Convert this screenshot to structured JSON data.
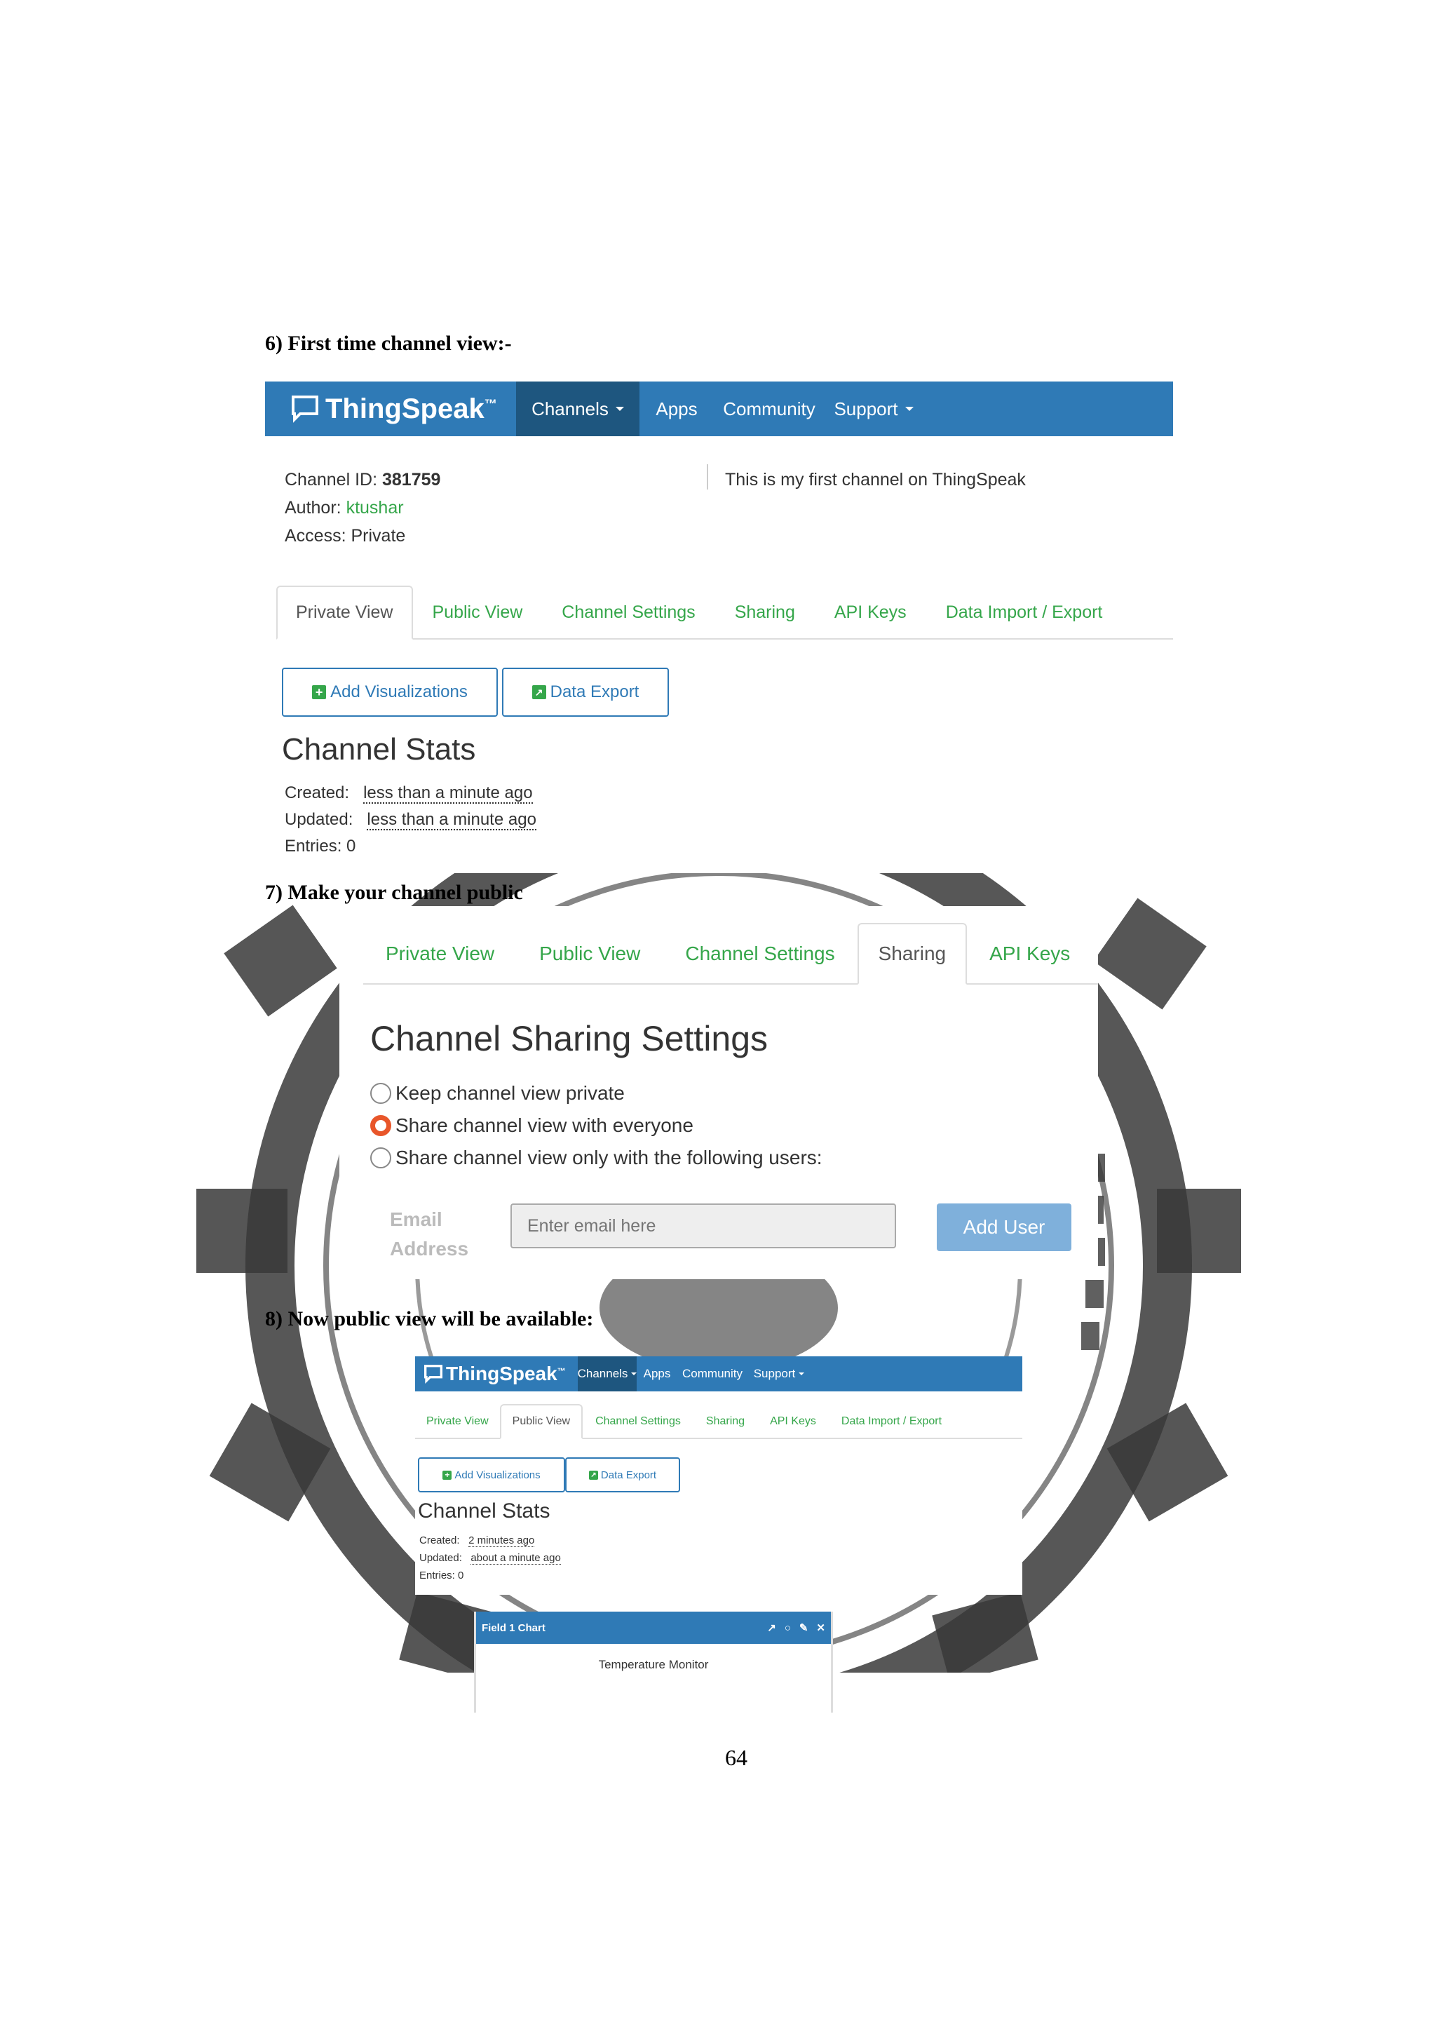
{
  "headings": {
    "h6": "6) First time channel view:-",
    "h7": "7) Make your channel public",
    "h8": "8) Now public view will be available:"
  },
  "page_number": "64",
  "nav": {
    "brand": "ThingSpeak",
    "tm": "™",
    "channels": "Channels",
    "apps": "Apps",
    "community": "Community",
    "support": "Support"
  },
  "channel": {
    "id_label": "Channel ID:",
    "id_value": "381759",
    "author_label": "Author:",
    "author_value": "ktushar",
    "access_label": "Access:",
    "access_value": "Private",
    "description": "This is my first channel on ThingSpeak"
  },
  "tabs": {
    "private_view": "Private View",
    "public_view": "Public View",
    "channel_settings": "Channel Settings",
    "sharing": "Sharing",
    "api_keys": "API Keys",
    "data_import_export": "Data Import / Export"
  },
  "buttons": {
    "add_visualizations": "Add Visualizations",
    "data_export": "Data Export",
    "add_user": "Add User"
  },
  "stats1": {
    "title": "Channel Stats",
    "created_label": "Created:",
    "created_value": "less than a minute ago",
    "updated_label": "Updated:",
    "updated_value": "less than a minute ago",
    "entries": "Entries: 0"
  },
  "sharing": {
    "title": "Channel Sharing Settings",
    "options": [
      "Keep channel view private",
      "Share channel view with everyone",
      "Share channel view only with the following users:"
    ],
    "selected_index": 1,
    "email_label_1": "Email",
    "email_label_2": "Address",
    "email_placeholder": "Enter email here"
  },
  "stats2": {
    "title": "Channel Stats",
    "created_label": "Created:",
    "created_value": "2 minutes ago",
    "updated_label": "Updated:",
    "updated_value": "about a minute ago",
    "entries": "Entries: 0"
  },
  "field_chart": {
    "header": "Field 1 Chart",
    "title": "Temperature Monitor"
  },
  "colors": {
    "nav_blue": "#2f7ab6",
    "nav_active": "#1e567f",
    "tab_green": "#35a64a",
    "radio_selected": "#e8562a",
    "add_user_button": "#7fb0db"
  }
}
